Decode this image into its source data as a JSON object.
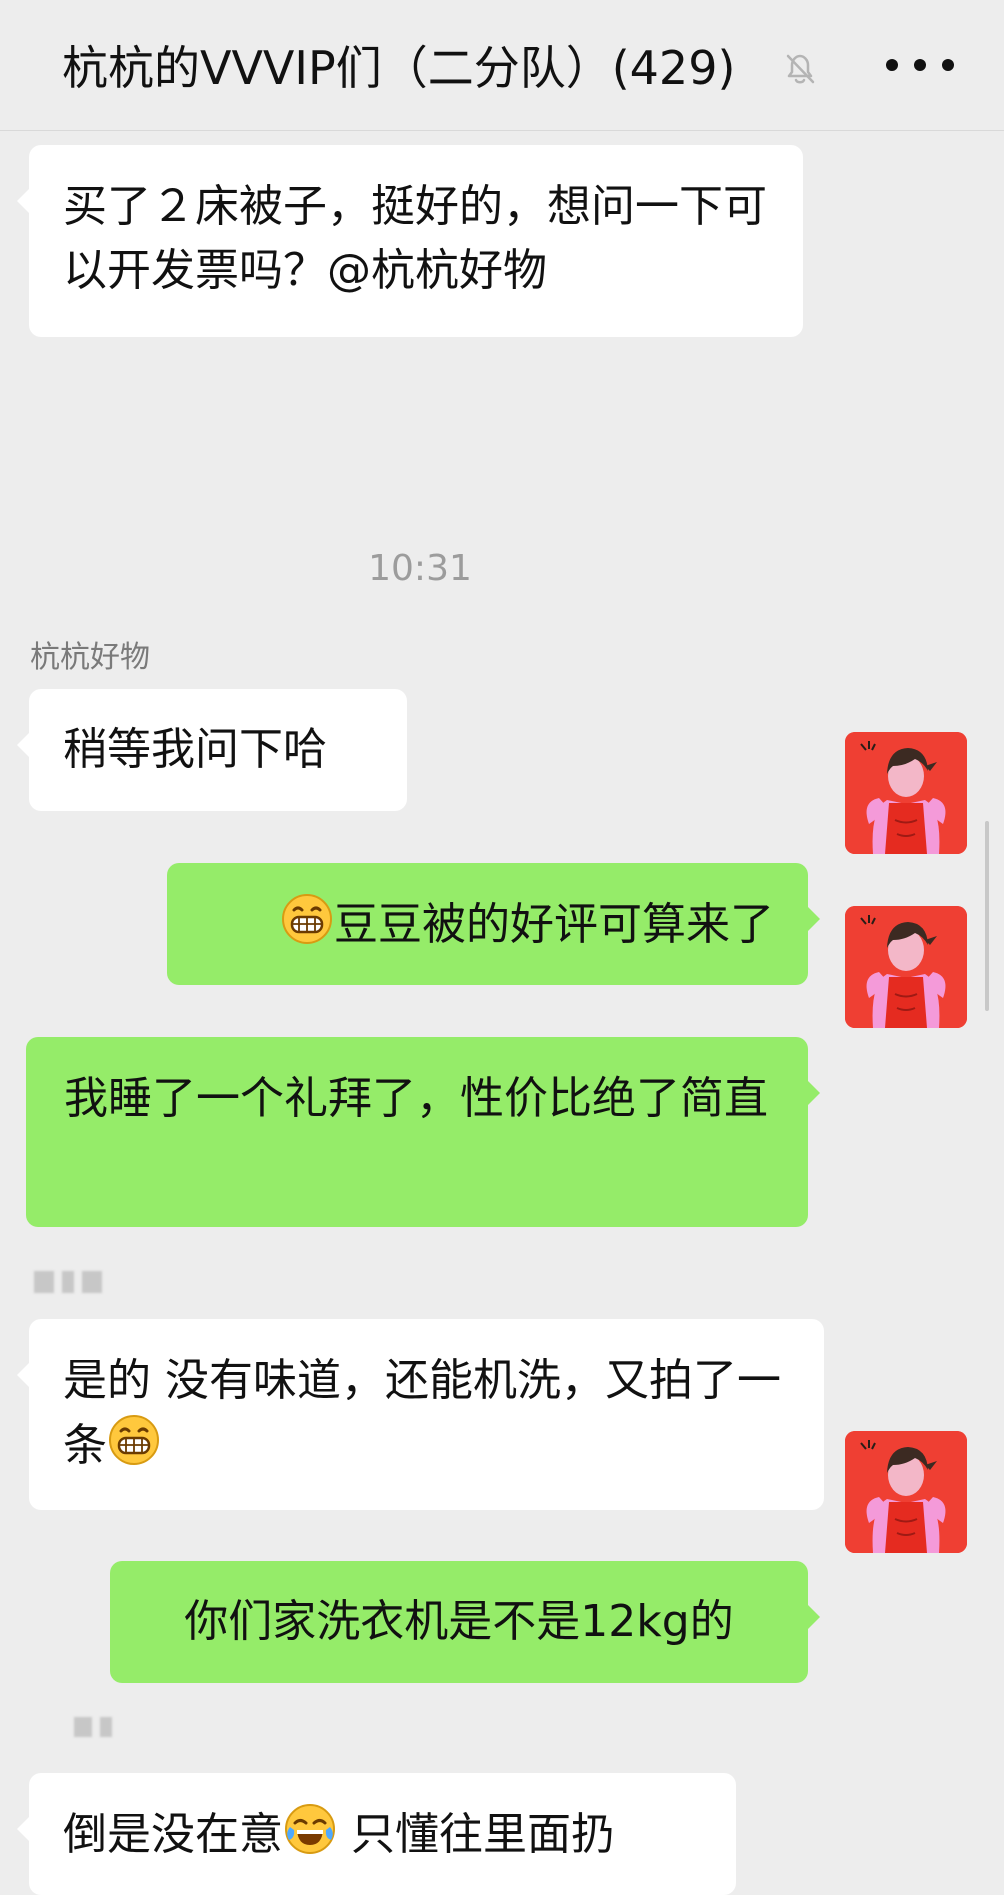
{
  "header": {
    "title": "杭杭的VVVIP们（二分队）(429)",
    "muted_icon": "bell-off-icon",
    "more_icon": "more-horizontal-icon"
  },
  "chat": {
    "messages": [
      {
        "side": "left",
        "text": "买了２床被子，挺好的，想问一下可以开发票吗？@杭杭好物"
      },
      {
        "type": "time",
        "text": "10:31"
      },
      {
        "side": "left",
        "sender": "杭杭好物",
        "text": "稍等我问下哈"
      },
      {
        "side": "right",
        "text_before_emoji": "",
        "emoji": "grinning-face-emoji",
        "text_after_emoji": "豆豆被的好评可算来了"
      },
      {
        "side": "right",
        "text": "我睡了一个礼拜了，性价比绝了简直"
      },
      {
        "side": "left",
        "text_before_emoji": "是的 没有味道，还能机洗，又拍了一条",
        "emoji": "grinning-face-emoji"
      },
      {
        "side": "right",
        "text": "你们家洗衣机是不是12kg的"
      },
      {
        "side": "left",
        "text_before_emoji": "倒是没在意",
        "emoji": "tears-of-joy-emoji",
        "text_after_emoji": " 只懂往里面扔"
      }
    ]
  },
  "colors": {
    "background": "#ededed",
    "incoming_bubble": "#ffffff",
    "outgoing_bubble": "#95ec69",
    "timestamp": "#9c9c9c",
    "sender_name": "#7a7a7a",
    "avatar_red": "#ef3f33"
  }
}
